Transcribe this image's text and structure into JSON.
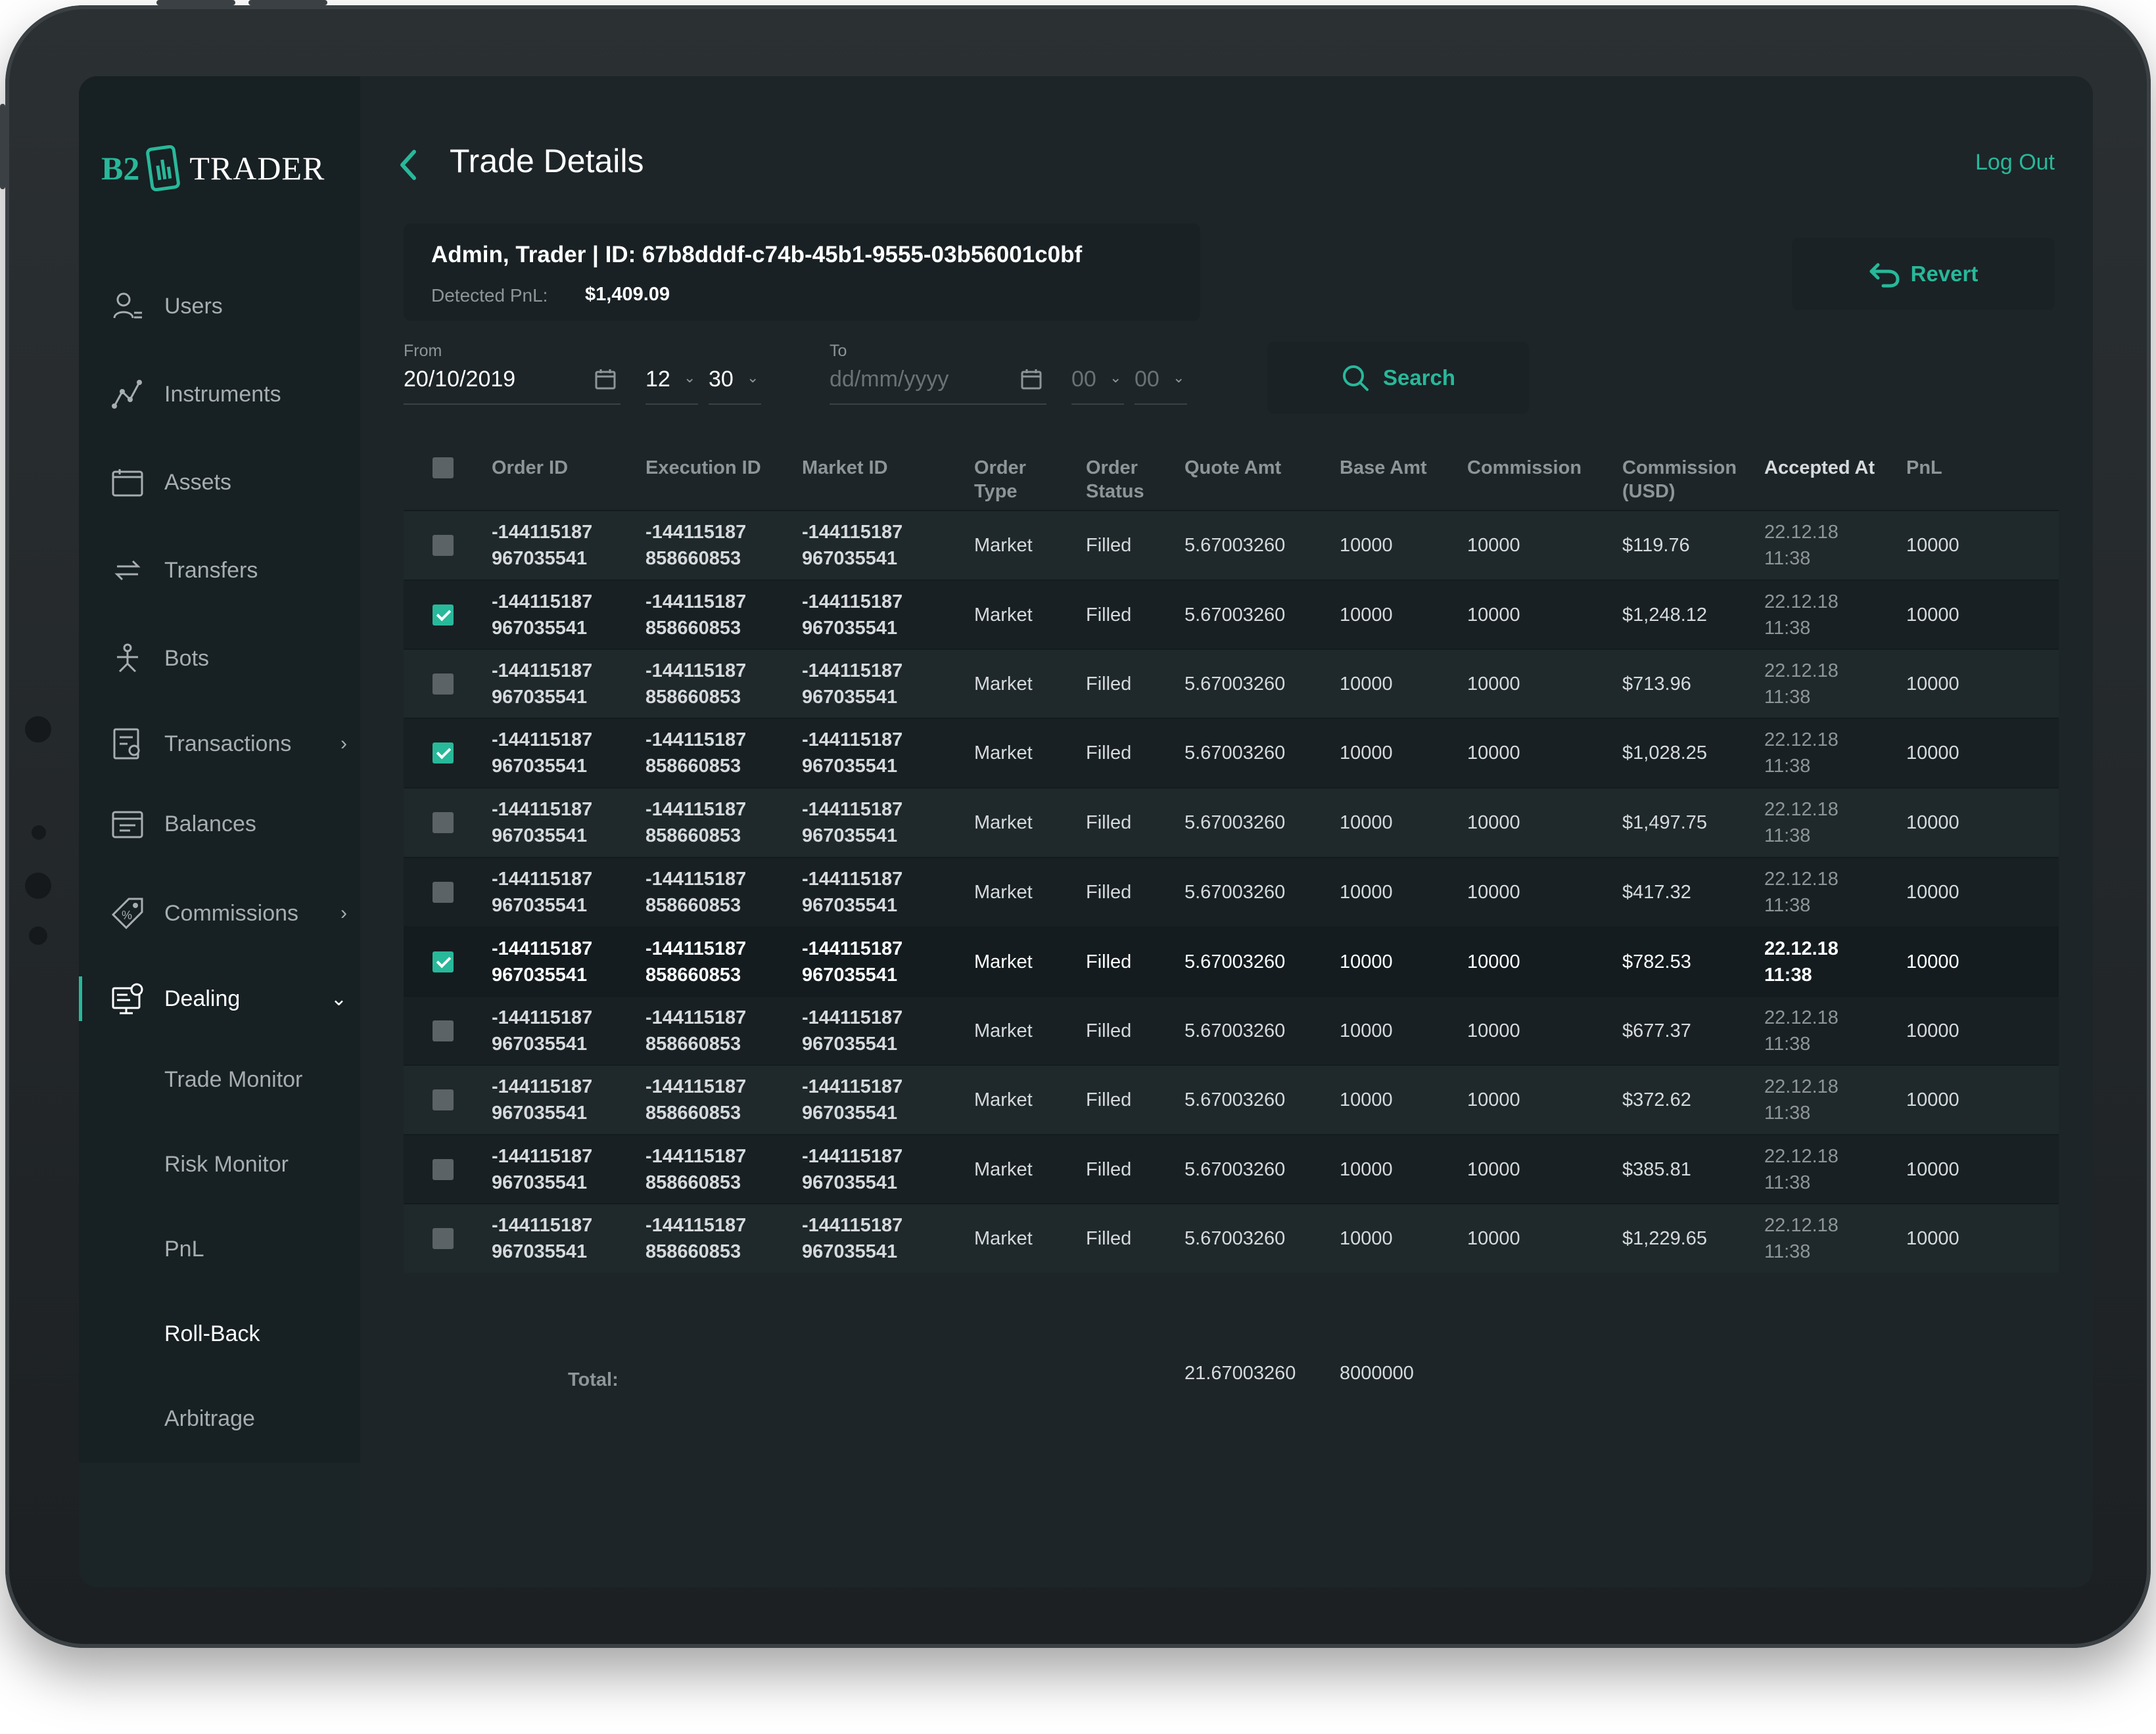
{
  "app": {
    "logo_b2": "B2",
    "logo_trader": "TRADER"
  },
  "header": {
    "title": "Trade Details",
    "logout": "Log Out"
  },
  "sidebar": {
    "items": [
      {
        "label": "Users",
        "icon": "user-icon"
      },
      {
        "label": "Instruments",
        "icon": "instruments-icon"
      },
      {
        "label": "Assets",
        "icon": "assets-icon"
      },
      {
        "label": "Transfers",
        "icon": "transfers-icon"
      },
      {
        "label": "Bots",
        "icon": "bots-icon"
      },
      {
        "label": "Transactions",
        "icon": "transactions-icon",
        "arrow": "›"
      },
      {
        "label": "Balances",
        "icon": "balances-icon"
      },
      {
        "label": "Commissions",
        "icon": "commissions-icon",
        "arrow": "›"
      },
      {
        "label": "Dealing",
        "icon": "dealing-icon",
        "arrow": "⌄"
      }
    ],
    "subitems": [
      "Trade Monitor",
      "Risk Monitor",
      "PnL",
      "Roll-Back",
      "Arbitrage"
    ],
    "active_sub": "Roll-Back"
  },
  "info": {
    "title": "Admin, Trader | ID: 67b8dddf-c74b-45b1-9555-03b56001c0bf",
    "pnl_label": "Detected PnL:",
    "pnl_value": "$1,409.09"
  },
  "revert_label": "Revert",
  "filters": {
    "from_label": "From",
    "from_date": "20/10/2019",
    "from_hour": "12",
    "from_min": "30",
    "to_label": "To",
    "to_date_placeholder": "dd/mm/yyyy",
    "to_hour": "00",
    "to_min": "00",
    "search_label": "Search"
  },
  "table": {
    "headers": {
      "order_id": "Order ID",
      "execution_id": "Execution ID",
      "market_id": "Market ID",
      "order_type_1": "Order",
      "order_type_2": "Type",
      "order_status_1": "Order",
      "order_status_2": "Status",
      "quote_amt": "Quote Amt",
      "base_amt": "Base Amt",
      "commission": "Commission",
      "commission_usd_1": "Commission",
      "commission_usd_2": "(USD)",
      "accepted_at": "Accepted At",
      "pnl": "PnL"
    },
    "rows": [
      {
        "checked": false,
        "oid1": "-144115187",
        "oid2": "967035541",
        "eid1": "-144115187",
        "eid2": "858660853",
        "mid1": "-144115187",
        "mid2": "967035541",
        "type": "Market",
        "status": "Filled",
        "quote": "5.67003260",
        "base": "10000",
        "commission": "10000",
        "commission_usd": "$119.76",
        "date": "22.12.18",
        "time": "11:38",
        "pnl": "10000"
      },
      {
        "checked": true,
        "oid1": "-144115187",
        "oid2": "967035541",
        "eid1": "-144115187",
        "eid2": "858660853",
        "mid1": "-144115187",
        "mid2": "967035541",
        "type": "Market",
        "status": "Filled",
        "quote": "5.67003260",
        "base": "10000",
        "commission": "10000",
        "commission_usd": "$1,248.12",
        "date": "22.12.18",
        "time": "11:38",
        "pnl": "10000"
      },
      {
        "checked": false,
        "oid1": "-144115187",
        "oid2": "967035541",
        "eid1": "-144115187",
        "eid2": "858660853",
        "mid1": "-144115187",
        "mid2": "967035541",
        "type": "Market",
        "status": "Filled",
        "quote": "5.67003260",
        "base": "10000",
        "commission": "10000",
        "commission_usd": "$713.96",
        "date": "22.12.18",
        "time": "11:38",
        "pnl": "10000"
      },
      {
        "checked": true,
        "oid1": "-144115187",
        "oid2": "967035541",
        "eid1": "-144115187",
        "eid2": "858660853",
        "mid1": "-144115187",
        "mid2": "967035541",
        "type": "Market",
        "status": "Filled",
        "quote": "5.67003260",
        "base": "10000",
        "commission": "10000",
        "commission_usd": "$1,028.25",
        "date": "22.12.18",
        "time": "11:38",
        "pnl": "10000"
      },
      {
        "checked": false,
        "oid1": "-144115187",
        "oid2": "967035541",
        "eid1": "-144115187",
        "eid2": "858660853",
        "mid1": "-144115187",
        "mid2": "967035541",
        "type": "Market",
        "status": "Filled",
        "quote": "5.67003260",
        "base": "10000",
        "commission": "10000",
        "commission_usd": "$1,497.75",
        "date": "22.12.18",
        "time": "11:38",
        "pnl": "10000"
      },
      {
        "checked": false,
        "oid1": "-144115187",
        "oid2": "967035541",
        "eid1": "-144115187",
        "eid2": "858660853",
        "mid1": "-144115187",
        "mid2": "967035541",
        "type": "Market",
        "status": "Filled",
        "quote": "5.67003260",
        "base": "10000",
        "commission": "10000",
        "commission_usd": "$417.32",
        "date": "22.12.18",
        "time": "11:38",
        "pnl": "10000"
      },
      {
        "checked": true,
        "highlight": true,
        "oid1": "-144115187",
        "oid2": "967035541",
        "eid1": "-144115187",
        "eid2": "858660853",
        "mid1": "-144115187",
        "mid2": "967035541",
        "type": "Market",
        "status": "Filled",
        "quote": "5.67003260",
        "base": "10000",
        "commission": "10000",
        "commission_usd": "$782.53",
        "date": "22.12.18",
        "time": "11:38",
        "pnl": "10000"
      },
      {
        "checked": false,
        "oid1": "-144115187",
        "oid2": "967035541",
        "eid1": "-144115187",
        "eid2": "858660853",
        "mid1": "-144115187",
        "mid2": "967035541",
        "type": "Market",
        "status": "Filled",
        "quote": "5.67003260",
        "base": "10000",
        "commission": "10000",
        "commission_usd": "$677.37",
        "date": "22.12.18",
        "time": "11:38",
        "pnl": "10000"
      },
      {
        "checked": false,
        "oid1": "-144115187",
        "oid2": "967035541",
        "eid1": "-144115187",
        "eid2": "858660853",
        "mid1": "-144115187",
        "mid2": "967035541",
        "type": "Market",
        "status": "Filled",
        "quote": "5.67003260",
        "base": "10000",
        "commission": "10000",
        "commission_usd": "$372.62",
        "date": "22.12.18",
        "time": "11:38",
        "pnl": "10000"
      },
      {
        "checked": false,
        "oid1": "-144115187",
        "oid2": "967035541",
        "eid1": "-144115187",
        "eid2": "858660853",
        "mid1": "-144115187",
        "mid2": "967035541",
        "type": "Market",
        "status": "Filled",
        "quote": "5.67003260",
        "base": "10000",
        "commission": "10000",
        "commission_usd": "$385.81",
        "date": "22.12.18",
        "time": "11:38",
        "pnl": "10000"
      },
      {
        "checked": false,
        "oid1": "-144115187",
        "oid2": "967035541",
        "eid1": "-144115187",
        "eid2": "858660853",
        "mid1": "-144115187",
        "mid2": "967035541",
        "type": "Market",
        "status": "Filled",
        "quote": "5.67003260",
        "base": "10000",
        "commission": "10000",
        "commission_usd": "$1,229.65",
        "date": "22.12.18",
        "time": "11:38",
        "pnl": "10000"
      }
    ],
    "total_label": "Total:",
    "total_quote": "21.67003260",
    "total_base": "8000000"
  },
  "colors": {
    "accent": "#28b89a",
    "background": "#1d2528",
    "sidebar": "#172022"
  }
}
